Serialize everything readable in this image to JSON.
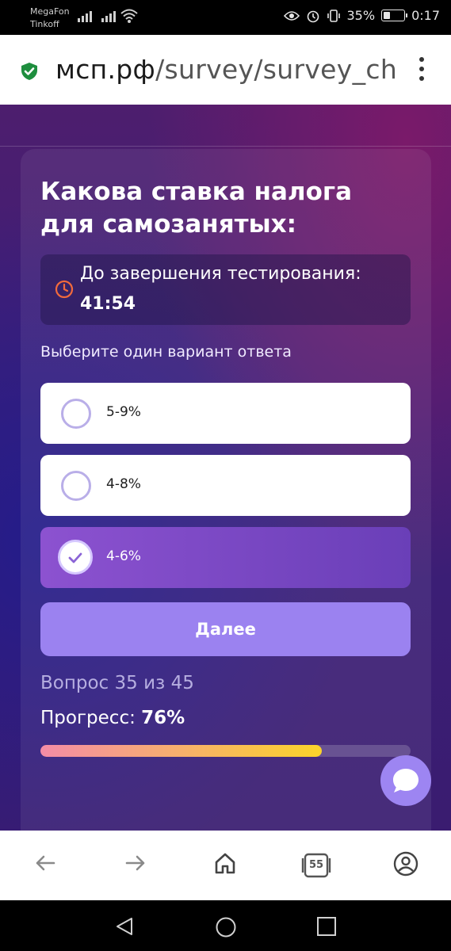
{
  "status_bar": {
    "carrier_1": "MegaFon",
    "carrier_2": "Tinkoff",
    "battery_percent": "35%",
    "battery_level": 0.35,
    "time": "0:17"
  },
  "browser": {
    "url_host": "мсп.рф",
    "url_path": "/survey/survey_chec",
    "tabs_count": "55"
  },
  "survey": {
    "question": "Какова ставка налога для самозанятых:",
    "timer_label": "До завершения тестирования:",
    "timer_value": "41:54",
    "instruction": "Выберите один вариант ответа",
    "options": [
      {
        "label": "5-9%",
        "selected": false
      },
      {
        "label": "4-8%",
        "selected": false
      },
      {
        "label": "4-6%",
        "selected": true
      }
    ],
    "next_label": "Далее",
    "question_counter": "Вопрос 35 из 45",
    "progress_prefix": "Прогресс:",
    "progress_value": "76%",
    "progress_fraction": 0.76
  },
  "colors": {
    "accent": "#9b82f0",
    "selected_option": "#7c48c4",
    "secure_green": "#1e8e3e",
    "clock_orange": "#f26a3c"
  },
  "icons": {
    "secure": "shield-check-icon",
    "menu": "kebab-menu-icon",
    "timer": "clock-icon",
    "check": "checkmark-icon",
    "chat": "chat-bubble-icon",
    "back": "arrow-left-icon",
    "forward": "arrow-right-icon",
    "home": "home-icon",
    "tabs": "tabs-icon",
    "account": "account-icon"
  }
}
